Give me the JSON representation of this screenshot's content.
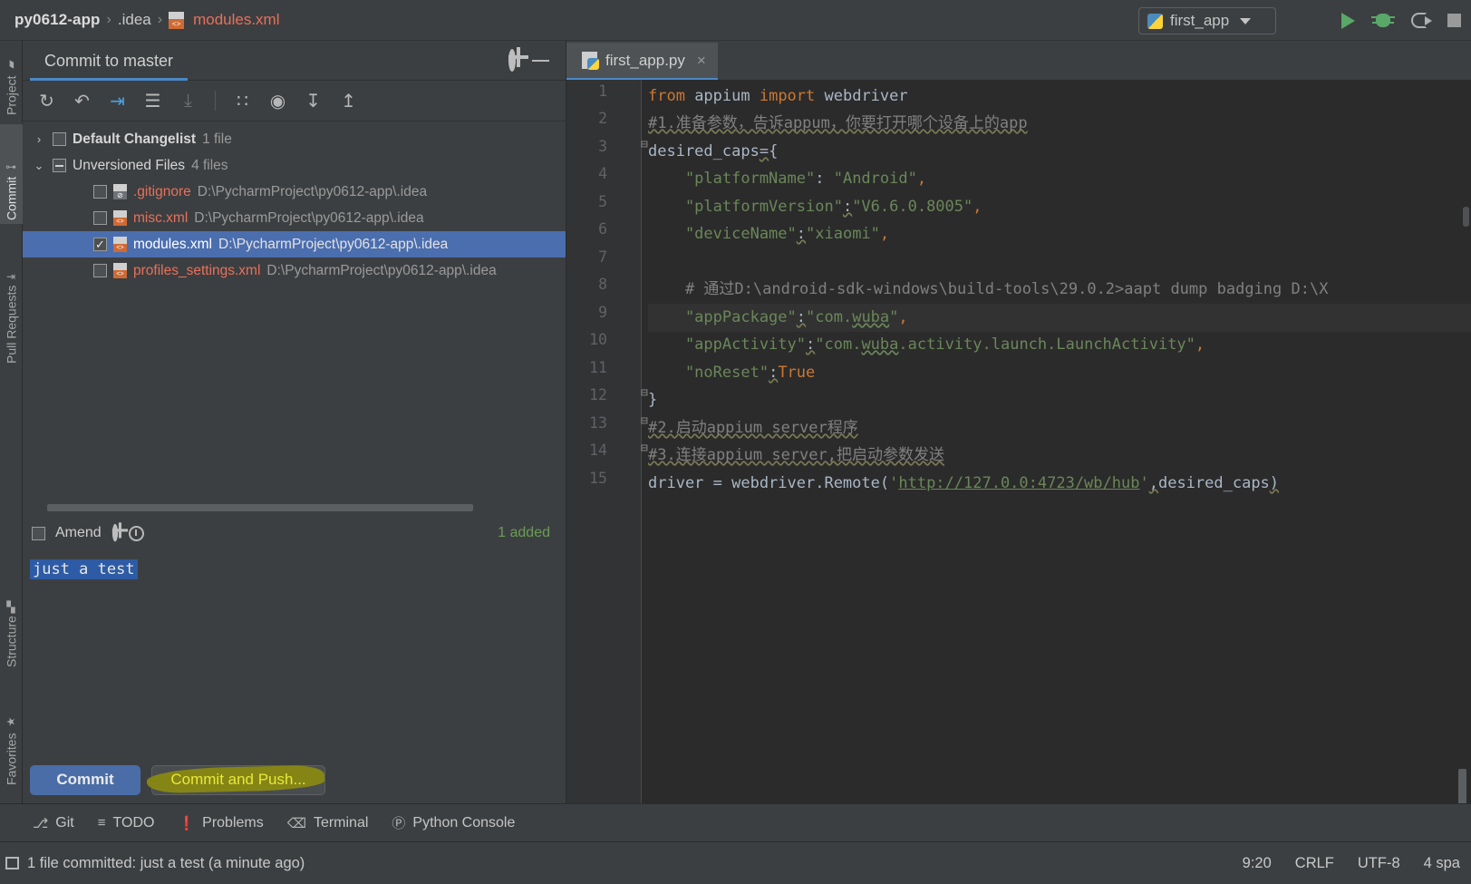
{
  "window": {
    "breadcrumb": {
      "project": "py0612-app",
      "folder": ".idea",
      "file": "modules.xml",
      "separator": "›"
    },
    "run_config": {
      "name": "first_app"
    },
    "toolbar_icons": [
      "run-icon",
      "debug-icon",
      "run-with-coverage-icon",
      "stop-icon"
    ]
  },
  "left_strip": {
    "tabs": [
      {
        "label": "Project",
        "icon": "folder-icon",
        "selected": false
      },
      {
        "label": "Commit",
        "icon": "commit-icon",
        "selected": true
      },
      {
        "label": "Pull Requests",
        "icon": "pull-request-icon",
        "selected": false
      },
      {
        "label": "Structure",
        "icon": "structure-icon",
        "selected": false
      },
      {
        "label": "Favorites",
        "icon": "star-icon",
        "selected": false
      }
    ]
  },
  "commit_panel": {
    "title": "Commit to master",
    "gear_tooltip": "gear-icon",
    "minimize_tooltip": "minimize-icon",
    "toolbar": [
      {
        "name": "refresh-changes-icon",
        "glyph": "↻",
        "style": "normal"
      },
      {
        "name": "rollback-icon",
        "glyph": "↶",
        "style": "normal"
      },
      {
        "name": "show-diff-icon",
        "glyph": "⇥",
        "style": "blue"
      },
      {
        "name": "commit-message-history-icon",
        "glyph": "☰",
        "style": "normal"
      },
      {
        "name": "shelve-changes-icon",
        "glyph": "⤓",
        "style": "dim"
      },
      {
        "name": "group-by-icon",
        "glyph": "∷",
        "style": "normal"
      },
      {
        "name": "preview-diff-icon",
        "glyph": "◉",
        "style": "normal"
      },
      {
        "name": "expand-all-icon",
        "glyph": "↧",
        "style": "normal"
      },
      {
        "name": "collapse-all-icon",
        "glyph": "↥",
        "style": "normal"
      }
    ],
    "tree": [
      {
        "type": "group",
        "arrow": "›",
        "checkbox": "empty",
        "label": "Default Changelist",
        "count": "1 file",
        "expanded": false
      },
      {
        "type": "group",
        "arrow": "⌄",
        "checkbox": "dash",
        "label": "Unversioned Files",
        "count": "4 files",
        "expanded": true
      },
      {
        "type": "file",
        "checkbox": "empty",
        "icon": "gitignore-file-icon",
        "name": ".gitignore",
        "path": "D:\\PycharmProject\\py0612-app\\.idea",
        "selected": false
      },
      {
        "type": "file",
        "checkbox": "empty",
        "icon": "xml-file-icon",
        "name": "misc.xml",
        "path": "D:\\PycharmProject\\py0612-app\\.idea",
        "selected": false
      },
      {
        "type": "file",
        "checkbox": "checked",
        "icon": "xml-file-icon",
        "name": "modules.xml",
        "path": "D:\\PycharmProject\\py0612-app\\.idea",
        "selected": true
      },
      {
        "type": "file",
        "checkbox": "empty",
        "icon": "xml-file-icon",
        "name": "profiles_settings.xml",
        "path": "D:\\PycharmProject\\py0612-app\\.idea",
        "selected": false
      }
    ],
    "amend": {
      "label": "Amend",
      "checked": false
    },
    "amend_icons": [
      "commit-options-gear-icon",
      "commit-history-clock-icon"
    ],
    "added_status": "1 added",
    "commit_message": "just a test",
    "buttons": {
      "commit": "Commit",
      "commit_and_push": "Commit and Push...",
      "highlight_color": "#8a8a10",
      "highlight_text_color": "#e8e83a"
    }
  },
  "editor": {
    "tab": {
      "label": "first_app.py",
      "icon": "python-file-icon",
      "close": "×"
    },
    "status_hint": "\"appPackage\"",
    "lines": [
      {
        "n": "1",
        "fold": "",
        "bulb": false,
        "current": false
      },
      {
        "n": "2",
        "fold": "",
        "bulb": false,
        "current": false
      },
      {
        "n": "3",
        "fold": "⊟",
        "bulb": false,
        "current": false
      },
      {
        "n": "4",
        "fold": "",
        "bulb": false,
        "current": false
      },
      {
        "n": "5",
        "fold": "",
        "bulb": false,
        "current": false
      },
      {
        "n": "6",
        "fold": "",
        "bulb": false,
        "current": false
      },
      {
        "n": "7",
        "fold": "",
        "bulb": false,
        "current": false
      },
      {
        "n": "8",
        "fold": "",
        "bulb": false,
        "current": false
      },
      {
        "n": "9",
        "fold": "",
        "bulb": true,
        "current": true
      },
      {
        "n": "10",
        "fold": "",
        "bulb": false,
        "current": false
      },
      {
        "n": "11",
        "fold": "",
        "bulb": false,
        "current": false
      },
      {
        "n": "12",
        "fold": "⊟",
        "bulb": false,
        "current": false
      },
      {
        "n": "13",
        "fold": "⊟",
        "bulb": false,
        "current": false
      },
      {
        "n": "14",
        "fold": "⊟",
        "bulb": false,
        "current": false
      },
      {
        "n": "15",
        "fold": "",
        "bulb": false,
        "current": false
      }
    ],
    "source": [
      "from appium import webdriver",
      "#1.准备参数，告诉appum，你要打开哪个设备上的app",
      "desired_caps={",
      "    \"platformName\": \"Android\",",
      "    \"platformVersion\":\"V6.6.0.8005\",",
      "    \"deviceName\":\"xiaomi\",",
      "",
      "    # 通过D:\\android-sdk-windows\\build-tools\\29.0.2>aapt dump badging D:\\X",
      "    \"appPackage\":\"com.wuba\",",
      "    \"appActivity\":\"com.wuba.activity.launch.LaunchActivity\",",
      "    \"noReset\":True",
      "}",
      "#2.启动appium server程序",
      "#3.连接appium server,把启动参数发送",
      "driver = webdriver.Remote('http://127.0.0:4723/wb/hub',desired_caps)"
    ]
  },
  "tool_windows": [
    {
      "label": "Git",
      "icon": "git-branch-icon",
      "glyph": "⎇"
    },
    {
      "label": "TODO",
      "icon": "todo-list-icon",
      "glyph": "≡"
    },
    {
      "label": "Problems",
      "icon": "problems-warning-icon",
      "glyph": "❗"
    },
    {
      "label": "Terminal",
      "icon": "terminal-icon",
      "glyph": "⌫"
    },
    {
      "label": "Python Console",
      "icon": "python-console-icon",
      "glyph": "Ⓟ"
    }
  ],
  "status_bar": {
    "message": "1 file committed: just a test (a minute ago)",
    "caret_position": "9:20",
    "line_separator": "CRLF",
    "encoding": "UTF-8",
    "indent": "4 spa"
  }
}
